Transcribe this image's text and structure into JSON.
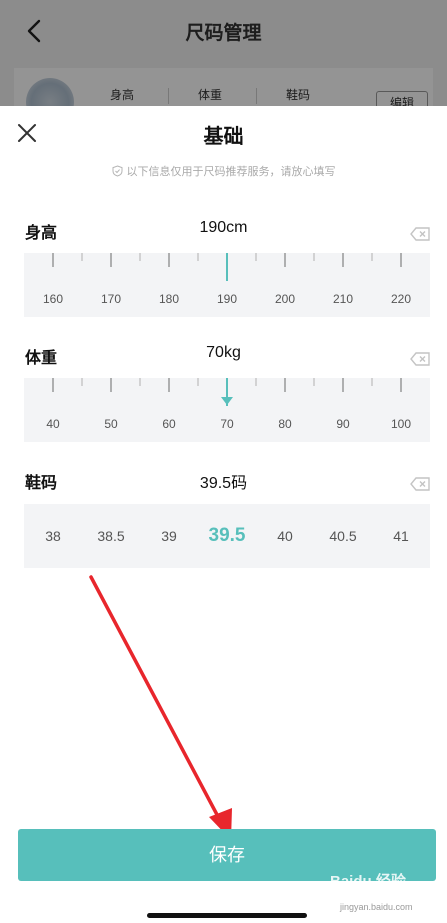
{
  "background_page": {
    "title": "尺码管理",
    "labels": [
      "身高",
      "体重",
      "鞋码"
    ],
    "edit_label": "编辑"
  },
  "sheet": {
    "title": "基础",
    "notice": "以下信息仅用于尺码推荐服务，请放心填写"
  },
  "height": {
    "label": "身高",
    "value": "190cm",
    "ticks": [
      "160",
      "170",
      "180",
      "190",
      "200",
      "210",
      "220"
    ],
    "selected_tick": "190"
  },
  "weight": {
    "label": "体重",
    "value": "70kg",
    "ticks": [
      "40",
      "50",
      "60",
      "70",
      "80",
      "90",
      "100"
    ],
    "selected_tick": "70"
  },
  "shoe": {
    "label": "鞋码",
    "value": "39.5码",
    "options": [
      "38",
      "38.5",
      "39",
      "39.5",
      "40",
      "40.5",
      "41"
    ],
    "selected": "39.5"
  },
  "save_label": "保存",
  "watermark": {
    "brand": "Baidu 经验",
    "url": "jingyan.baidu.com"
  },
  "colors": {
    "accent": "#57bfbb",
    "annotation_arrow": "#e8262c"
  }
}
